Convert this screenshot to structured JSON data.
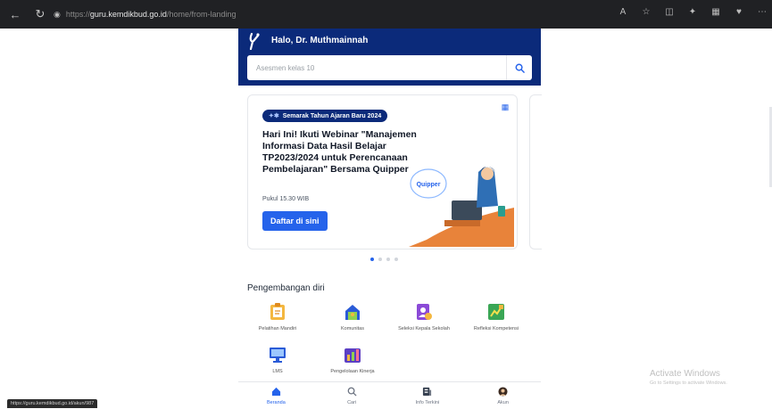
{
  "browser": {
    "url_scheme": "https://",
    "url_host": "guru.kemdikbud.go.id",
    "url_path": "/home/from-landing"
  },
  "header": {
    "greeting": "Halo, Dr. Muthmainnah",
    "search_placeholder": "Asesmen kelas 10"
  },
  "banner": {
    "pill": "Semarak Tahun Ajaran Baru 2024",
    "title": "Hari Ini! Ikuti Webinar \"Manajemen Informasi Data Hasil Belajar TP2023/2024 untuk Perencanaan Pembelajaran\" Bersama Quipper",
    "time": "Pukul 15.30 WIB",
    "cta": "Daftar di sini",
    "bubble": "Quipper",
    "slides": 4,
    "active_slide": 1
  },
  "section": {
    "title": "Pengembangan diri"
  },
  "tiles": [
    {
      "label": "Pelatihan Mandiri",
      "icon": "clipboard-icon"
    },
    {
      "label": "Komunitas",
      "icon": "community-house-icon"
    },
    {
      "label": "Seleksi Kepala Sekolah",
      "icon": "selection-icon"
    },
    {
      "label": "Refleksi Kompetensi",
      "icon": "reflection-icon"
    },
    {
      "label": "LMS",
      "icon": "lms-monitor-icon"
    },
    {
      "label": "Pengelolaan Kinerja",
      "icon": "performance-icon"
    }
  ],
  "bottom_nav": [
    {
      "label": "Beranda",
      "icon": "home-icon",
      "active": true
    },
    {
      "label": "Cari",
      "icon": "search-icon",
      "active": false
    },
    {
      "label": "Info Terkini",
      "icon": "news-icon",
      "active": false
    },
    {
      "label": "Akun",
      "icon": "account-avatar-icon",
      "active": false
    }
  ],
  "status_link": "https://guru.kemdikbud.go.id/akun/987",
  "watermark": {
    "title": "Activate Windows",
    "subtitle": "Go to Settings to activate Windows."
  },
  "colors": {
    "header_bg": "#0b2a7a",
    "accent": "#2563eb"
  }
}
